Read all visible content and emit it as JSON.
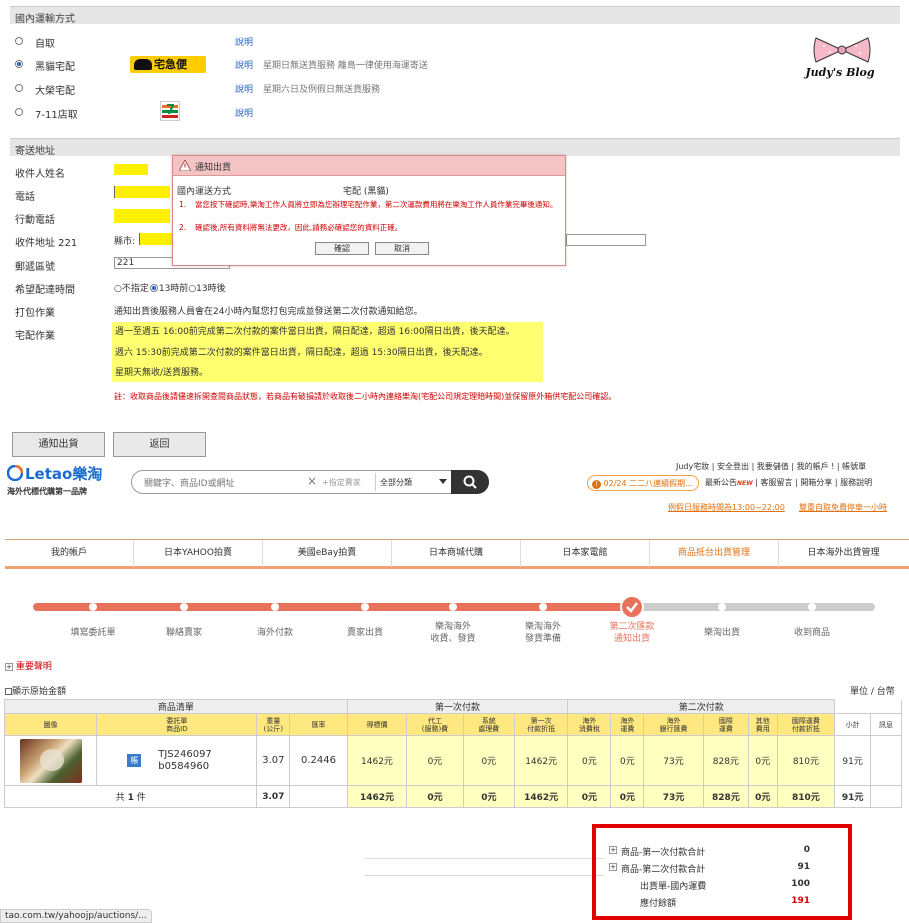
{
  "shipping": {
    "section_title": "國內運輸方式",
    "options": [
      {
        "label": "自取",
        "link": "說明",
        "note": "",
        "selected": false
      },
      {
        "label": "黑貓宅配",
        "link": "說明",
        "note": "星期日無送貨服務 離島一律使用海運寄送",
        "selected": true,
        "logo": "宅急便"
      },
      {
        "label": "大榮宅配",
        "link": "說明",
        "note": "星期六日及例假日無送貨服務",
        "selected": false
      },
      {
        "label": "7-11店取",
        "link": "說明",
        "note": "",
        "selected": false
      }
    ]
  },
  "blog_logo": "Judy's Blog",
  "address": {
    "section_title": "寄送地址",
    "name_label": "收件人姓名",
    "phone_label": "電話",
    "mobile_label": "行動電話",
    "addr_label": "收件地址 221",
    "county_label": "縣市:",
    "zip_label": "郵遞區號",
    "zip_value": "221",
    "time_label": "希望配達時間",
    "time_opt1": "○不指定",
    "time_opt2": "13時前",
    "time_opt3": "○13時後",
    "pack_label": "打包作業",
    "pack_text": "通知出貨後服務人員會在24小時內幫您打包完成並發送第二次付款通知給您。",
    "deliv_label": "宅配作業",
    "deliv_lines": [
      "週一至週五 16:00前完成第二次付款的案件當日出貨，隔日配達，超過 16:00隔日出貨，後天配達。",
      "週六 15:30前完成第二次付款的案件當日出貨，隔日配達，超過 15:30隔日出貨，後天配達。",
      "星期天無收/送貨服務。"
    ],
    "notice": "註：收取商品後請儘速拆開查閱商品狀態，若商品有破損請於收取後二小時內連絡樂淘(宅配公司規定理賠時間)並保留原外箱供宅配公司確認。"
  },
  "modal": {
    "title": "通知出貨",
    "row_label": "國內運送方式",
    "row_value": "宅配 (黑貓)",
    "item1": "當您按下確認時,樂淘工作人員將立即為您辦理宅配作業，第二次運款費用將在樂淘工作人員作業完畢後通知。",
    "item2": "確認後,所有資料將無法更改，因此,請務必確認您的資料正確。",
    "ok": "確認",
    "cancel": "取消"
  },
  "buttons": {
    "notify": "通知出貨",
    "back": "返回"
  },
  "letao": {
    "brand": "Letao樂淘",
    "slogan": "海外代標代購第一品牌",
    "search_placeholder": "關鍵字、商品ID或網址",
    "clear": "×",
    "designated": "+指定賣家",
    "category": "全部分類",
    "top_links": "Judy宅妝 | 安全登出 | 我要儲值 | 我的帳戶 ! | 帳號單",
    "notice_pill": "02/24 二二八連續假期...",
    "news": "最新公告",
    "news_badge": "NEW",
    "service": "客服留言",
    "share": "開箱分享",
    "guide": "服務說明",
    "promo1": "例假日服務時間為13:00~22:00",
    "promo2": "雙重自取免費停車一小時"
  },
  "nav": [
    "我的帳戶",
    "日本YAHOO拍賣",
    "美國eBay拍賣",
    "日本商城代購",
    "日本家電館",
    "商品抵台出貨管理",
    "日本海外出貨管理"
  ],
  "steps": [
    {
      "label": "填寫委託單"
    },
    {
      "label": "聯絡賣家"
    },
    {
      "label": "海外付款"
    },
    {
      "label": "賣家出貨"
    },
    {
      "label": "樂淘海外\n收貨、發貨"
    },
    {
      "label": "樂淘海外\n發貨準備"
    },
    {
      "label": "第二次匯款\n通知出貨"
    },
    {
      "label": "樂淘出貨"
    },
    {
      "label": "收到商品"
    }
  ],
  "important": "重要聲明",
  "show_original": "顯示原始金額",
  "unit": "單位 / 台幣",
  "table": {
    "groups": [
      "商品清單",
      "第一次付款",
      "第二次付款"
    ],
    "headers": [
      "圖像",
      "委託單\n商品ID",
      "重量\n(公斤)",
      "匯率",
      "得標價",
      "代工\n(服務)費",
      "系統\n處理費",
      "第一次\n付款折抵",
      "海外\n消費稅",
      "海外\n運費",
      "海外\n銀行匯費",
      "國際\n運費",
      "其他\n費用",
      "國際運費\n付款折抵",
      "小計",
      "訊息"
    ],
    "row": {
      "badge": "帳",
      "order": "TJS246097",
      "item": "b0584960",
      "weight": "3.07",
      "rate": "0.2446",
      "bid": "1462元",
      "service": "0元",
      "system": "0元",
      "first_offset": "1462元",
      "tax": "0元",
      "ovs_ship": "0元",
      "bank": "73元",
      "intl": "828元",
      "other": "0元",
      "intl_offset": "810元",
      "subtotal": "91元",
      "msg": ""
    },
    "sum": {
      "label_pre": "共",
      "count": "1",
      "label_post": "件",
      "weight": "3.07",
      "bid": "1462元",
      "service": "0元",
      "system": "0元",
      "first_offset": "1462元",
      "tax": "0元",
      "ovs_ship": "0元",
      "bank": "73元",
      "intl": "828元",
      "other": "0元",
      "intl_offset": "810元",
      "subtotal": "91元"
    }
  },
  "totals": [
    {
      "label": "商品-第一次付款合計",
      "value": "0",
      "expand": "+"
    },
    {
      "label": "商品-第二次付款合計",
      "value": "91",
      "expand": "+"
    },
    {
      "label": "出貨單-國內運費",
      "value": "100",
      "expand": ""
    },
    {
      "label": "應付餘額",
      "value": "191",
      "expand": ""
    }
  ],
  "status_url": "tao.com.tw/yahoojp/auctions/..."
}
